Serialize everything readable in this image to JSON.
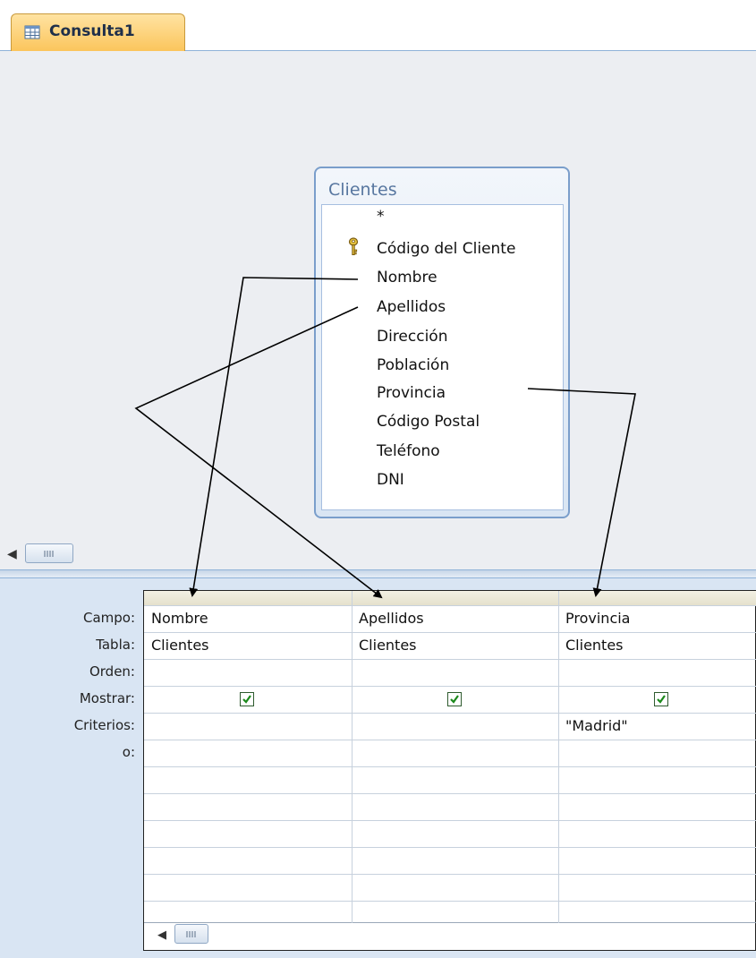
{
  "tab": {
    "label": "Consulta1",
    "icon": "query-icon"
  },
  "table": {
    "title": "Clientes",
    "fields": [
      "*",
      "Código del Cliente",
      "Nombre",
      "Apellidos",
      "Dirección",
      "Población",
      "Provincia",
      "Código Postal",
      "Teléfono",
      "DNI"
    ],
    "primary_key_icon": "key-icon"
  },
  "grid": {
    "row_labels": [
      "Campo:",
      "Tabla:",
      "Orden:",
      "Mostrar:",
      "Criterios:",
      "o:"
    ],
    "columns": [
      {
        "campo": "Nombre",
        "tabla": "Clientes",
        "orden": "",
        "mostrar": true,
        "criterios": ""
      },
      {
        "campo": "Apellidos",
        "tabla": "Clientes",
        "orden": "",
        "mostrar": true,
        "criterios": ""
      },
      {
        "campo": "Provincia",
        "tabla": "Clientes",
        "orden": "",
        "mostrar": true,
        "criterios": "\"Madrid\""
      }
    ]
  },
  "colors": {
    "tab_bg": "#fbc55c",
    "design_bg": "#eceef2",
    "grid_area_bg": "#d9e5f3",
    "table_border": "#7a9ecb",
    "check_color": "#1c8a1c"
  }
}
